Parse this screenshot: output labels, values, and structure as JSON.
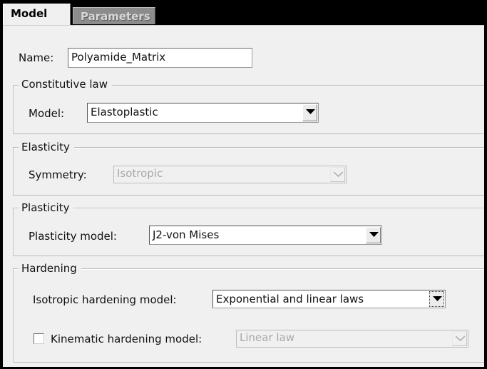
{
  "tabs": [
    {
      "label": "Model",
      "active": true
    },
    {
      "label": "Parameters",
      "active": false
    }
  ],
  "name": {
    "label": "Name:",
    "value": "Polyamide_Matrix"
  },
  "constitutive": {
    "title": "Constitutive law",
    "model_label": "Model:",
    "model_value": "Elastoplastic"
  },
  "elasticity": {
    "title": "Elasticity",
    "symmetry_label": "Symmetry:",
    "symmetry_value": "Isotropic",
    "symmetry_enabled": false
  },
  "plasticity": {
    "title": "Plasticity",
    "model_label": "Plasticity model:",
    "model_value": "J2-von Mises"
  },
  "hardening": {
    "title": "Hardening",
    "isotropic_label": "Isotropic hardening model:",
    "isotropic_value": "Exponential and linear laws",
    "kinematic_label": "Kinematic hardening model:",
    "kinematic_checked": false,
    "kinematic_value": "Linear law",
    "kinematic_enabled": false
  },
  "icons": {
    "dropdown": "chevron-down-icon"
  },
  "colors": {
    "panel": "#f0f0f0",
    "frame": "#000000",
    "inactive_tab": "#8c8c8c"
  }
}
